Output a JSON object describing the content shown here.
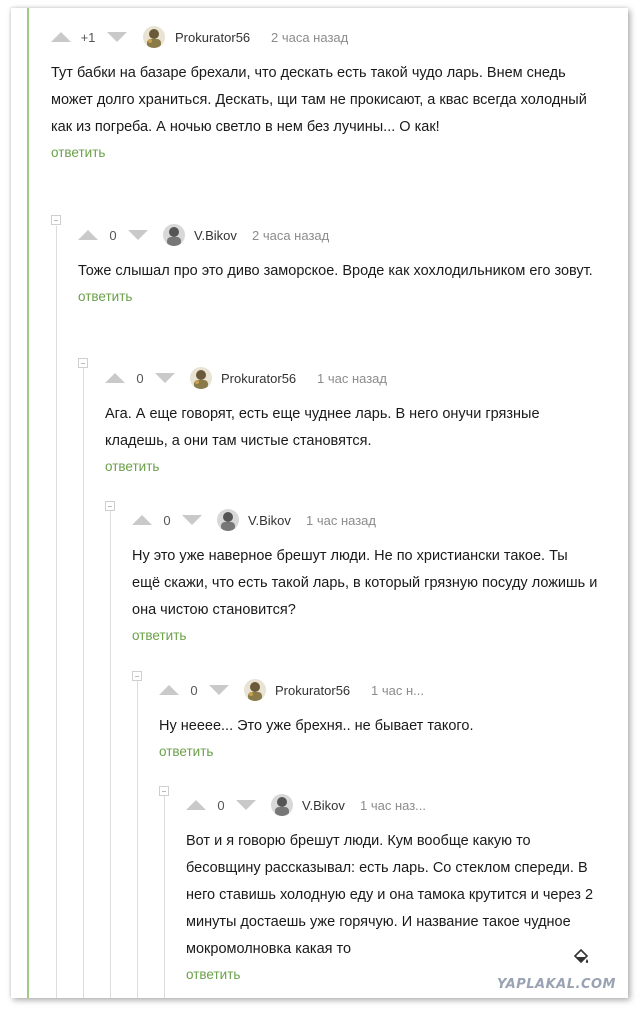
{
  "comments": [
    {
      "rating": "+1",
      "username": "Prokurator56",
      "time": "2 часа назад",
      "text": "Тут бабки на базаре брехали, что дескать есть такой чудо ларь. Внем снедь может долго храниться. Дескать, щи там не прокисают, а квас всегда холодный как из погреба. А ночью светло в нем без лучины... О как!",
      "reply": "ответить",
      "avatar": "avatar-prokurator"
    },
    {
      "rating": "0",
      "username": "V.Bikov",
      "time": "2 часа назад",
      "text": "Тоже слышал про это диво заморское. Вроде как хохлодильником его зовут.",
      "reply": "ответить",
      "avatar": "avatar-vbikov"
    },
    {
      "rating": "0",
      "username": "Prokurator56",
      "time": "1 час назад",
      "text": "Ага. А еще говорят, есть еще чуднее ларь. В него онучи грязные кладешь, а они там чистые становятся.",
      "reply": "ответить",
      "avatar": "avatar-prokurator"
    },
    {
      "rating": "0",
      "username": "V.Bikov",
      "time": "1 час назад",
      "text": "Ну это уже наверное брешут люди. Не по христиански такое. Ты ещё скажи, что есть такой ларь, в который грязную посуду ложишь и она чистою становится?",
      "reply": "ответить",
      "avatar": "avatar-vbikov"
    },
    {
      "rating": "0",
      "username": "Prokurator56",
      "time": "1 час н...",
      "text": "Ну неeee... Это уже брехня.. не бывает такого.",
      "reply": "ответить",
      "avatar": "avatar-prokurator"
    },
    {
      "rating": "0",
      "username": "V.Bikov",
      "time": "1 час наз...",
      "text": "Вот и я говорю брешут люди. Кум вообще какую то бесовщину рассказывал: есть ларь. Со стеклом спереди. В него ставишь холодную еду и она тамока крутится и через 2 минуты достаешь уже горячую. И название такое чудное мокромолновка какая то",
      "reply": "ответить",
      "avatar": "avatar-vbikov"
    }
  ],
  "watermark": "YAPLAKAL.COM",
  "colors": {
    "reply": "#6aa04a",
    "vote_arrow": "#c9c9c9",
    "time": "#8c8c8c",
    "thread_line": "#9ccd7f"
  }
}
